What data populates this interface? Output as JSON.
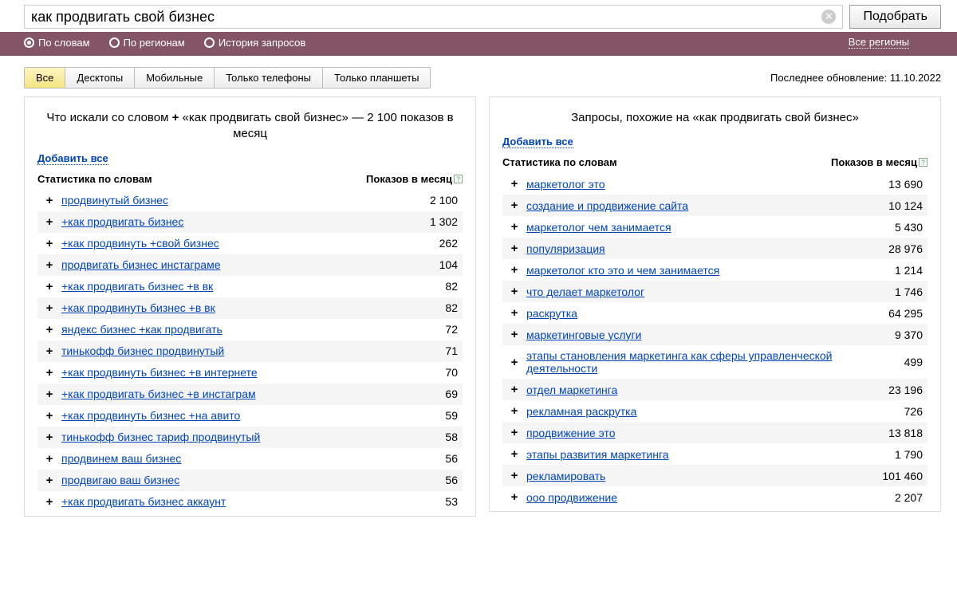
{
  "search": {
    "value": "как продвигать свой бизнес",
    "button": "Подобрать"
  },
  "radios": {
    "by_words": "По словам",
    "by_regions": "По регионам",
    "history": "История запросов"
  },
  "region_link": "Все регионы",
  "device_tabs": [
    "Все",
    "Десктопы",
    "Мобильные",
    "Только телефоны",
    "Только планшеты"
  ],
  "last_update_label": "Последнее обновление:",
  "last_update_value": "11.10.2022",
  "left_panel": {
    "title_pre": "Что искали со словом",
    "title_query": "«как продвигать свой бизнес»",
    "title_post": "— 2 100 показов в месяц",
    "add_all": "Добавить все",
    "th_stat": "Статистика по словам",
    "th_shows": "Показов в месяц",
    "rows": [
      {
        "kw": "продвинутый бизнес",
        "shows": "2 100"
      },
      {
        "kw": "+как продвигать бизнес",
        "shows": "1 302"
      },
      {
        "kw": "+как продвинуть +свой бизнес",
        "shows": "262"
      },
      {
        "kw": "продвигать бизнес инстаграме",
        "shows": "104"
      },
      {
        "kw": "+как продвигать бизнес +в вк",
        "shows": "82"
      },
      {
        "kw": "+как продвинуть бизнес +в вк",
        "shows": "82"
      },
      {
        "kw": "яндекс бизнес +как продвигать",
        "shows": "72"
      },
      {
        "kw": "тинькофф бизнес продвинутый",
        "shows": "71"
      },
      {
        "kw": "+как продвинуть бизнес +в интернете",
        "shows": "70"
      },
      {
        "kw": "+как продвигать бизнес +в инстаграм",
        "shows": "69"
      },
      {
        "kw": "+как продвинуть бизнес +на авито",
        "shows": "59"
      },
      {
        "kw": "тинькофф бизнес тариф продвинутый",
        "shows": "58"
      },
      {
        "kw": "продвинем ваш бизнес",
        "shows": "56"
      },
      {
        "kw": "продвигаю ваш бизнес",
        "shows": "56"
      },
      {
        "kw": "+как продвигать бизнес аккаунт",
        "shows": "53"
      }
    ]
  },
  "right_panel": {
    "title": "Запросы, похожие на «как продвигать свой бизнес»",
    "add_all": "Добавить все",
    "th_stat": "Статистика по словам",
    "th_shows": "Показов в месяц",
    "rows": [
      {
        "kw": "маркетолог это",
        "shows": "13 690"
      },
      {
        "kw": "создание и продвижение сайта",
        "shows": "10 124"
      },
      {
        "kw": "маркетолог чем занимается",
        "shows": "5 430"
      },
      {
        "kw": "популяризация",
        "shows": "28 976"
      },
      {
        "kw": "маркетолог кто это и чем занимается",
        "shows": "1 214"
      },
      {
        "kw": "что делает маркетолог",
        "shows": "1 746"
      },
      {
        "kw": "раскрутка",
        "shows": "64 295"
      },
      {
        "kw": "маркетинговые услуги",
        "shows": "9 370"
      },
      {
        "kw": "этапы становления маркетинга как сферы управленческой деятельности",
        "shows": "499"
      },
      {
        "kw": "отдел маркетинга",
        "shows": "23 196"
      },
      {
        "kw": "рекламная раскрутка",
        "shows": "726"
      },
      {
        "kw": "продвижение это",
        "shows": "13 818"
      },
      {
        "kw": "этапы развития маркетинга",
        "shows": "1 790"
      },
      {
        "kw": "рекламировать",
        "shows": "101 460"
      },
      {
        "kw": "ооо продвижение",
        "shows": "2 207"
      }
    ]
  }
}
